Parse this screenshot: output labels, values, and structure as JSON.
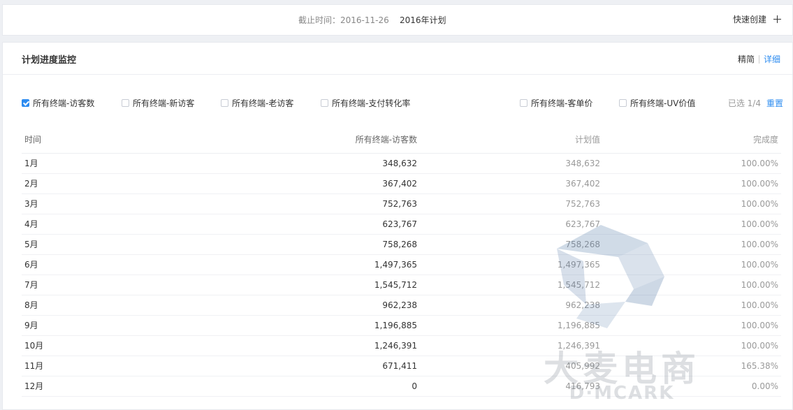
{
  "topbar": {
    "deadline_label": "截止时间：",
    "deadline_value": "2016-11-26",
    "plan_year": "2016年计划",
    "quick_create": "快速创建"
  },
  "panel": {
    "title": "计划进度监控",
    "view_simple": "精简",
    "view_detail": "详细"
  },
  "filters": [
    {
      "label": "所有终端-访客数",
      "checked": true
    },
    {
      "label": "所有终端-新访客",
      "checked": false
    },
    {
      "label": "所有终端-老访客",
      "checked": false
    },
    {
      "label": "所有终端-支付转化率",
      "checked": false
    },
    {
      "label": "所有终端-客单价",
      "checked": false
    },
    {
      "label": "所有终端-UV价值",
      "checked": false
    }
  ],
  "selection": {
    "count": "已选 1/4",
    "reset": "重置"
  },
  "table": {
    "headers": {
      "time": "时间",
      "visitors": "所有终端-访客数",
      "plan": "计划值",
      "rate": "完成度"
    },
    "rows": [
      {
        "time": "1月",
        "visitors": "348,632",
        "plan": "348,632",
        "rate": "100.00%"
      },
      {
        "time": "2月",
        "visitors": "367,402",
        "plan": "367,402",
        "rate": "100.00%"
      },
      {
        "time": "3月",
        "visitors": "752,763",
        "plan": "752,763",
        "rate": "100.00%"
      },
      {
        "time": "4月",
        "visitors": "623,767",
        "plan": "623,767",
        "rate": "100.00%"
      },
      {
        "time": "5月",
        "visitors": "758,268",
        "plan": "758,268",
        "rate": "100.00%"
      },
      {
        "time": "6月",
        "visitors": "1,497,365",
        "plan": "1,497,365",
        "rate": "100.00%"
      },
      {
        "time": "7月",
        "visitors": "1,545,712",
        "plan": "1,545,712",
        "rate": "100.00%"
      },
      {
        "time": "8月",
        "visitors": "962,238",
        "plan": "962,238",
        "rate": "100.00%"
      },
      {
        "time": "9月",
        "visitors": "1,196,885",
        "plan": "1,196,885",
        "rate": "100.00%"
      },
      {
        "time": "10月",
        "visitors": "1,246,391",
        "plan": "1,246,391",
        "rate": "100.00%"
      },
      {
        "time": "11月",
        "visitors": "671,411",
        "plan": "405,992",
        "rate": "165.38%"
      },
      {
        "time": "12月",
        "visitors": "0",
        "plan": "416,793",
        "rate": "0.00%"
      }
    ]
  },
  "watermark": {
    "text_cn": "大麦电商",
    "text_en": "D·MCARK",
    "icon": "logo-mark"
  },
  "colors": {
    "accent": "#2d8cf0",
    "muted": "#999999"
  }
}
